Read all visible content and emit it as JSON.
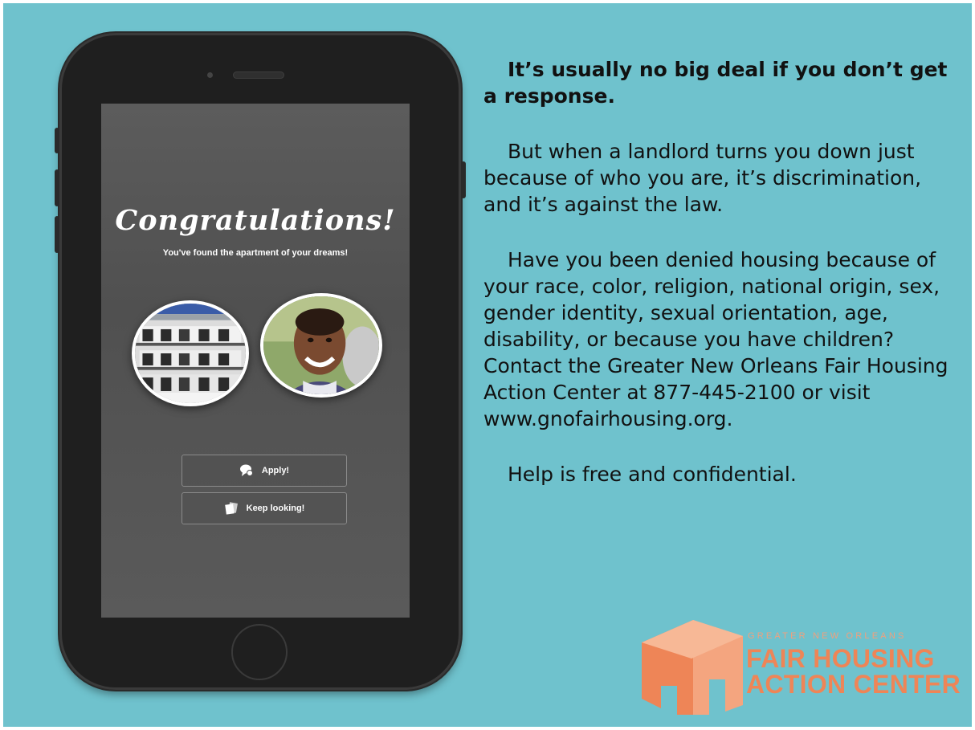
{
  "phone": {
    "headline": "Congratulations!",
    "subtitle": "You've found the apartment of your dreams!",
    "buttons": {
      "apply_label": "Apply!",
      "keep_looking_label": "Keep looking!"
    },
    "icons": {
      "apply": "chat-bubble-icon",
      "keep_looking": "cards-icon"
    }
  },
  "message": {
    "lead": "It’s usually no big deal if you don’t get a response.",
    "paragraph2": "But when a landlord turns you down just because of who you are, it’s discrimination, and it’s against the law.",
    "paragraph3": "Have you been denied housing because of your race, color, religion, national origin, sex, gender identity, sexual orientation, age, disability, or because you have children? Contact the Greater New Orleans Fair Housing Action Center at 877-445-2100 or visit www.gnofairhousing.org.",
    "paragraph4": "Help is free and confidential."
  },
  "logo": {
    "small_text": "GREATER NEW ORLEANS",
    "line1": "FAIR HOUSING",
    "line2": "ACTION CENTER"
  },
  "colors": {
    "background": "#6fc2cd",
    "phone_body": "#1f1f1f",
    "logo_orange": "#ee8557"
  }
}
